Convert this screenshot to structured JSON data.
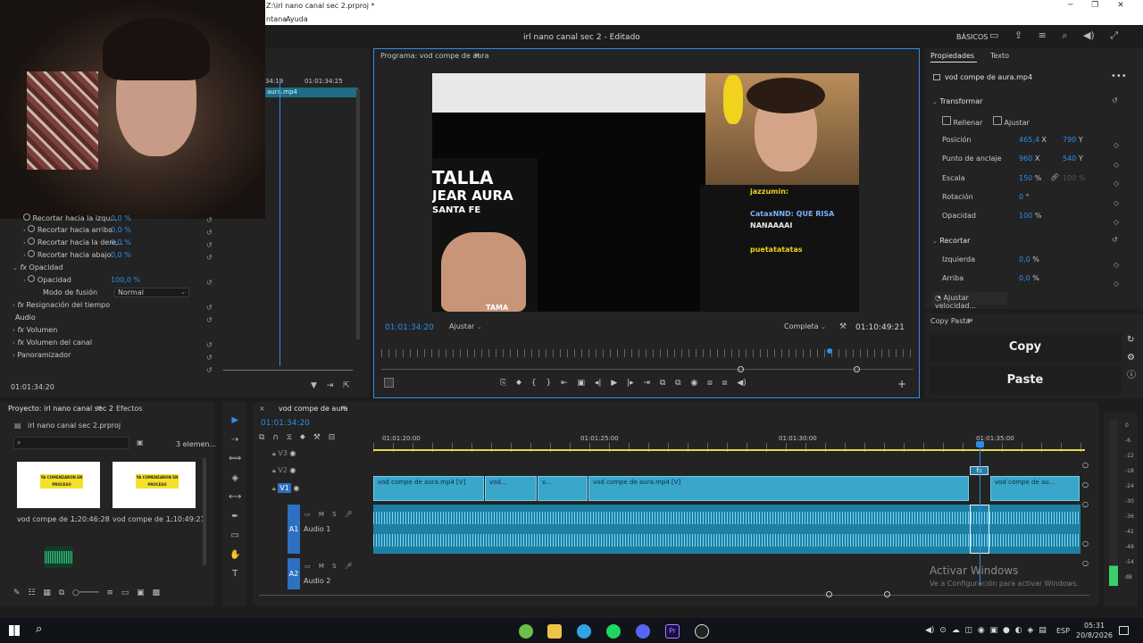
{
  "titlebar": {
    "path": "Z:\\irl nano canal sec 2.prproj *",
    "menu": [
      "ntana",
      "Ayuda"
    ]
  },
  "header": {
    "title": "irl nano canal sec 2 - Editado",
    "workspace": "BÁSICOS"
  },
  "effect_controls": {
    "clip_label": "aura.mp4",
    "time_tick": "01:01:34:25",
    "time_tick_left": "34:19",
    "rows": [
      {
        "label": "Recortar hacia la izqu...",
        "value": "0,0 %"
      },
      {
        "label": "Recortar hacia arriba",
        "value": "0,0 %"
      },
      {
        "label": "Recortar hacia la dere...",
        "value": "0,0 %"
      },
      {
        "label": "Recortar hacia abajo",
        "value": "0,0 %"
      }
    ],
    "opacity_group": "Opacidad",
    "opacity_label": "Opacidad",
    "opacity_value": "100,0 %",
    "blend_label": "Modo de fusión",
    "blend_value": "Normal",
    "time_remap": "Resignación del tiempo",
    "audio_section": "Audio",
    "audio_rows": [
      "Volumen",
      "Volumen del canal",
      "Panoramizador"
    ],
    "timecode": "01:01:34:20"
  },
  "program": {
    "title": "Programa: vod compe de aura",
    "timecode": "01:01:34:20",
    "fit": "Ajustar",
    "quality": "Completa",
    "duration": "01:10:49:21",
    "video_text": {
      "left_big1": "TALLA",
      "left_big2": "JEAR AURA",
      "left_big3": "SANTA FE",
      "bottom": "TAMA",
      "chat1": "jazzumin:",
      "chat2": "CataxNND: QUE RISA",
      "chat3": "NANAAAAI",
      "chat4": "puetatatatas"
    }
  },
  "properties": {
    "tabs": [
      "Propiedades",
      "Texto"
    ],
    "clip_name": "vod compe de aura.mp4",
    "transform": "Transformar",
    "fill": "Rellenar",
    "fit": "Ajustar",
    "rows": [
      {
        "label": "Posición",
        "x": "465,4",
        "xu": "X",
        "y": "790",
        "yu": "Y"
      },
      {
        "label": "Punto de anclaje",
        "x": "960",
        "xu": "X",
        "y": "540",
        "yu": "Y"
      },
      {
        "label": "Escala",
        "x": "150",
        "xu": "%",
        "y": "100",
        "yu": "%"
      },
      {
        "label": "Rotación",
        "x": "0",
        "xu": "°"
      },
      {
        "label": "Opacidad",
        "x": "100",
        "xu": "%"
      }
    ],
    "crop": "Recortar",
    "crop_rows": [
      {
        "label": "Izquierda",
        "value": "0,0",
        "unit": "%"
      },
      {
        "label": "Arriba",
        "value": "0,0",
        "unit": "%"
      }
    ],
    "speed": "Ajustar velocidad..."
  },
  "copypaste": {
    "title": "Copy Pasta",
    "copy": "Copy",
    "paste": "Paste"
  },
  "project": {
    "tab": "Proyecto: irl nano canal sec 2",
    "tab2": "Efectos",
    "file": "irl nano canal sec 2.prproj",
    "count": "3 elemen...",
    "items": [
      {
        "name": "vod compe de ...",
        "duration": "1:20:46:28",
        "thumb": "YA COMENZARON EN PROCESO"
      },
      {
        "name": "vod compe de ...",
        "duration": "1:10:49:21",
        "thumb": "YA COMENZARON EN PROCESO"
      }
    ]
  },
  "timeline": {
    "tab": "vod compe de aura",
    "timecode": "01:01:34:20",
    "ticks": [
      "01:01:20:00",
      "01:01:25:00",
      "01:01:30:00",
      "01:01:35:00"
    ],
    "tracks": [
      "V3",
      "V2",
      "V1",
      "A1",
      "A2"
    ],
    "a1_name": "Audio 1",
    "a2_name": "Audio 2",
    "clips": [
      "vod compe de aura.mp4 [V]",
      "vod...",
      "v...",
      "vod compe de aura.mp4 [V]",
      "vod compe de au..."
    ],
    "fx": "fx"
  },
  "watermark": {
    "line1": "Activar Windows",
    "line2": "Ve a Configuración para activar Windows."
  },
  "meter": [
    "0",
    "-6",
    "-12",
    "-18",
    "-24",
    "-30",
    "-36",
    "-42",
    "-48",
    "-54",
    "dB"
  ],
  "taskbar": {
    "lang": "ESP",
    "time": "05:31",
    "date": "20/8/2026"
  }
}
